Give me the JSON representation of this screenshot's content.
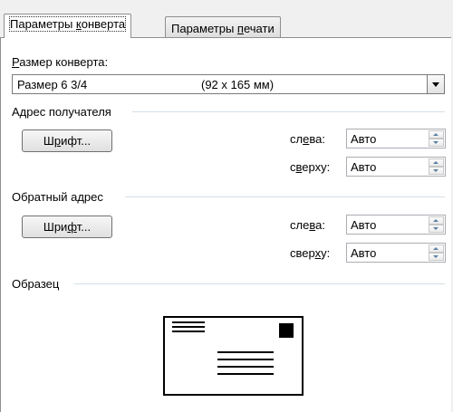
{
  "tabs": [
    {
      "pre": "Параметры ",
      "mn": "к",
      "post": "онверта",
      "active": true
    },
    {
      "pre": "Параметры  ",
      "mn": "п",
      "post": "ечати",
      "active": false
    }
  ],
  "envelope_size": {
    "label_mn": "Р",
    "label_rest": "азмер конверта:",
    "selected_size": "Размер 6 3/4",
    "selected_dims": "(92 x 165 мм)"
  },
  "recipient": {
    "title": "Адрес получателя",
    "font_button": {
      "pre": "Ш",
      "mn": "р",
      "post": "ифт..."
    },
    "left": {
      "pre": "сл",
      "mn": "е",
      "post": "ва:",
      "value": "Авто"
    },
    "top": {
      "pre": "с",
      "mn": "в",
      "post": "ерху:",
      "value": "Авто"
    }
  },
  "return_address": {
    "title": "Обратный адрес",
    "font_button": {
      "pre": "Шри",
      "mn": "ф",
      "post": "т..."
    },
    "left": {
      "pre": "сле",
      "mn": "в",
      "post": "а:",
      "value": "Авто"
    },
    "top": {
      "pre": "свер",
      "mn": "х",
      "post": "у:",
      "value": "Авто"
    }
  },
  "preview": {
    "title": "Образец"
  }
}
